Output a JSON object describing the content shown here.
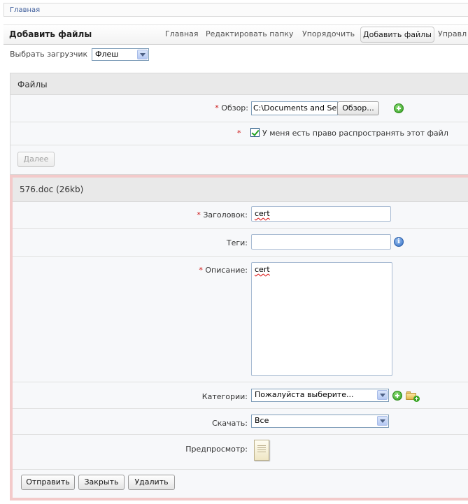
{
  "breadcrumb": {
    "home": "Главная"
  },
  "header": {
    "title": "Добавить файлы",
    "tabs": [
      {
        "label": "Главная"
      },
      {
        "label": "Редактировать папку"
      },
      {
        "label": "Упорядочить"
      },
      {
        "label": "Добавить файлы",
        "active": true
      },
      {
        "label": "Управл"
      }
    ]
  },
  "uploader": {
    "label": "Выбрать загрузчик",
    "selected": "Флеш"
  },
  "files_panel": {
    "title": "Файлы",
    "browse": {
      "required": "*",
      "label": "Обзор:",
      "value": "C:\\Documents and Settin",
      "button": "Обзор..."
    },
    "rights": {
      "required": "*",
      "label": "У меня есть право распространять этот файл",
      "checked": true
    },
    "next_button": "Далее"
  },
  "file_panel": {
    "title": "576.doc (26kb)",
    "fields": {
      "title_label": "Заголовок:",
      "title_value": "cert",
      "tags_label": "Теги:",
      "tags_value": "",
      "description_label": "Описание:",
      "description_value": "cert",
      "categories_label": "Категории:",
      "categories_value": "Пожалуйста выберите...",
      "download_label": "Скачать:",
      "download_value": "Все",
      "preview_label": "Предпросмотр:"
    },
    "required_mark": "*",
    "info_glyph": "i",
    "buttons": {
      "submit": "Отправить",
      "close": "Закрыть",
      "delete": "Удалить"
    }
  },
  "colors": {
    "link": "#3a5a99",
    "required": "#cc1111",
    "error_border": "#f3caca",
    "panel_header": "#e9e9e9"
  },
  "icons": [
    "add-icon",
    "info-icon",
    "add-folder-icon",
    "document-icon",
    "chevron-down-icon",
    "checkbox-checked-icon"
  ]
}
